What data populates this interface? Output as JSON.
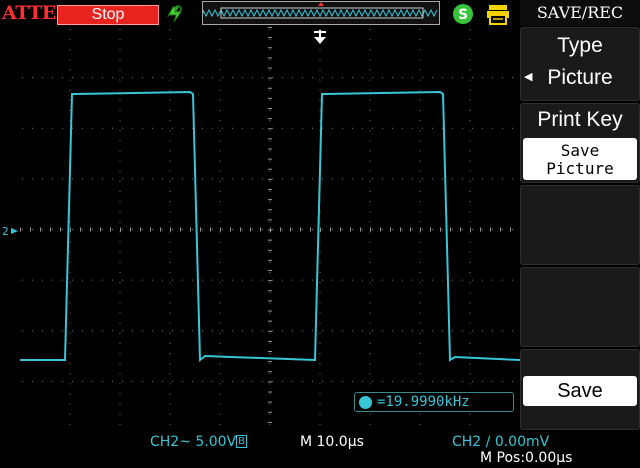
{
  "header": {
    "brand": "ATTEN",
    "status": "Stop"
  },
  "menu": {
    "title": "SAVE/REC",
    "type_label": "Type",
    "type_value": "Picture",
    "print_key_label": "Print Key",
    "save_picture_line1": "Save",
    "save_picture_line2": "Picture",
    "save_label": "Save"
  },
  "measure": {
    "frequency": "=19.9990kHz"
  },
  "footer": {
    "ch_scale": "CH2~ 5.00V",
    "bw_badge": "B",
    "timebase": "M 10.0μs",
    "trigger": "CH2 ∕ 0.00mV",
    "mpos": "M Pos:0.00μs"
  },
  "colors": {
    "trace": "#37c6d6",
    "status_bg": "#e8231e",
    "brand": "#ff2f2f",
    "grid": "#777777"
  },
  "icons": {
    "run_state": "green-recycle-icon",
    "storage": "green-s-icon",
    "printer": "yellow-printer-icon",
    "trigger_marker": "down-arrow-icon",
    "channel_marker": "ground-level-icon"
  }
}
